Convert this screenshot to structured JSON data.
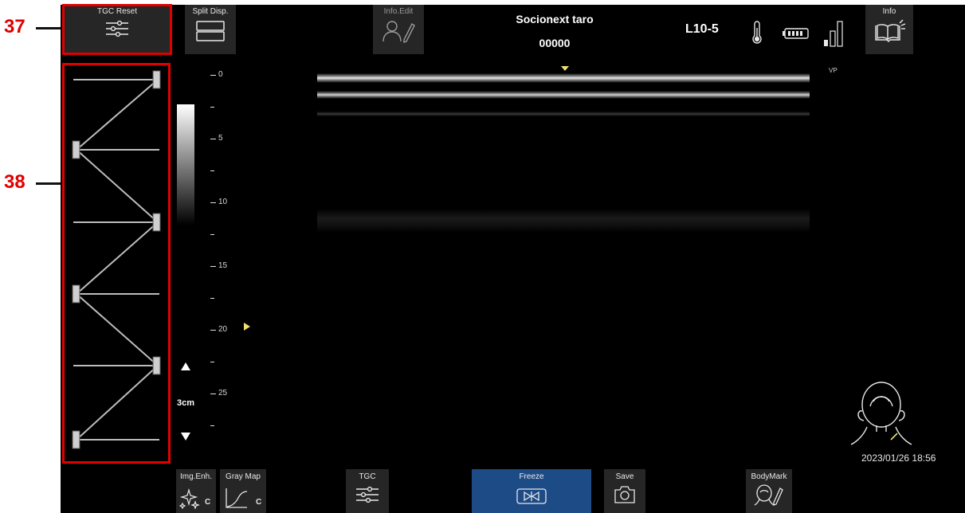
{
  "callouts": {
    "c37": "37",
    "c38": "38"
  },
  "topbar": {
    "tgc_reset": "TGC Reset",
    "split_disp": "Split Disp.",
    "info_edit": "Info.Edit",
    "patient_name": "Socionext taro",
    "patient_id": "00000",
    "probe": "L10-5",
    "info": "Info"
  },
  "depth_scale": {
    "labels": [
      "0",
      "5",
      "10",
      "15",
      "20",
      "25"
    ],
    "unit_label": "3cm"
  },
  "image": {
    "vp_label": "VP"
  },
  "datetime": "2023/01/26 18:56",
  "bottombar": {
    "img_enh": "Img.Enh.",
    "img_enh_mode": "C",
    "gray_map": "Gray Map",
    "gray_map_mode": "C",
    "tgc": "TGC",
    "freeze": "Freeze",
    "save": "Save",
    "bodymark": "BodyMark"
  },
  "colors": {
    "accent_red": "#e00000",
    "freeze_blue": "#1d4b86",
    "marker_yellow": "#f0e070"
  },
  "icons": [
    "sliders-icon",
    "split-display-icon",
    "person-edit-icon",
    "thermometer-icon",
    "battery-icon",
    "signal-icon",
    "book-icon",
    "sparkle-icon",
    "curve-icon",
    "freeze-icon",
    "camera-icon",
    "head-edit-icon"
  ]
}
